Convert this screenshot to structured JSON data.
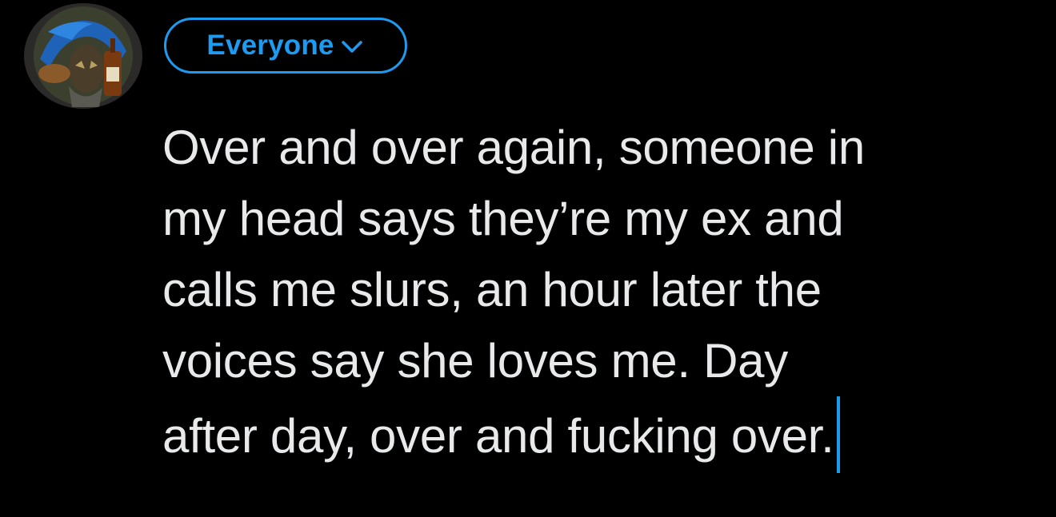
{
  "colors": {
    "background": "#000000",
    "accent": "#1d9bf0",
    "text": "#e7e9ea"
  },
  "header": {
    "avatar_icon": "user-avatar",
    "audience": {
      "label": "Everyone",
      "icon": "chevron-down-icon"
    }
  },
  "composer": {
    "lines": [
      "Over and over again, someone in",
      "my head says they’re my ex and",
      "calls me slurs, an hour later the",
      "voices say she loves me. Day",
      "after day, over and fucking over."
    ]
  }
}
